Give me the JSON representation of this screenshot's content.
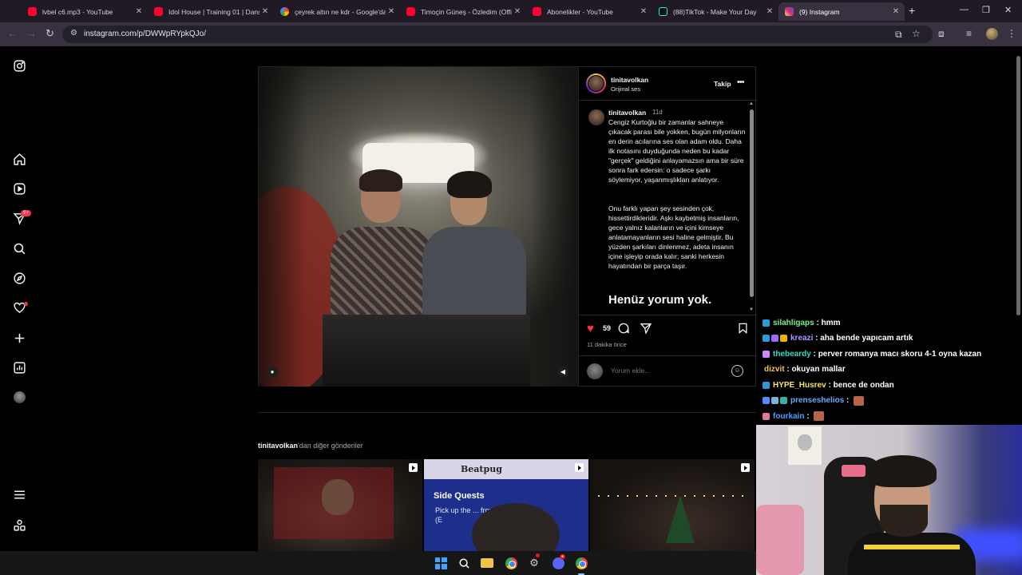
{
  "browser": {
    "tabs": [
      {
        "title": "lvbel c6.mp3 - YouTube",
        "icon": "youtube-icon",
        "fav": "yt"
      },
      {
        "title": "Idol House | Training 01 | Dans",
        "icon": "youtube-icon",
        "fav": "yt"
      },
      {
        "title": "çeyrek altın ne kdr - Google'da",
        "icon": "google-icon",
        "fav": "g"
      },
      {
        "title": "Timoçin Güneş - Özledim (Offic",
        "icon": "youtube-icon",
        "fav": "yt"
      },
      {
        "title": "Abonelikler - YouTube",
        "icon": "youtube-icon",
        "fav": "yt"
      },
      {
        "title": "(88)TikTok - Make Your Day",
        "icon": "tiktok-icon",
        "fav": "tt"
      },
      {
        "title": "(9) Instagram",
        "icon": "instagram-icon",
        "fav": "ig",
        "active": true
      }
    ],
    "url": "instagram.com/p/DWWpRYpkQJo/"
  },
  "nav": {
    "notification_badge": "9+"
  },
  "post": {
    "username": "tinitavolkan",
    "audio": "Orijinal ses",
    "follow_label": "Takip",
    "caption_user": "tinitavolkan",
    "caption_time": "11d",
    "caption_p1": "Cengiz Kurtoğlu bir zamanlar sahneye çıkacak parası bile yokken, bugün milyonların en derin acılarına ses olan adam oldu. Daha ilk notasını duyduğunda neden bu kadar \"gerçek\" geldiğini anlayamazsın ama bir süre sonra fark edersin: o sadece şarkı söylemiyor, yaşanmışlıkları anlatıyor.",
    "caption_p2": "Onu farklı yapan şey sesinden çok, hissettirdikleridir. Aşkı kaybetmiş insanların, gece yalnız kalanların ve içini kimseye anlatamayanların sesi haline gelmiştir. Bu yüzden şarkıları dinlenmez, adeta insanın içine işleyip orada kalır; sanki herkesin hayatından bir parça taşır.",
    "no_comments": "Henüz yorum yok.",
    "likes": "59",
    "time_ago": "11 dakika önce",
    "comment_placeholder": "Yorum ekle..."
  },
  "more_posts": {
    "user": "tinitavolkan",
    "suffix": "'dan diğer gönderiler",
    "thumb2_title": "Beatpug",
    "thumb2_heading": "Side Quests",
    "thumb2_text": "Pick up the ... from Night ... Stor ... (E"
  },
  "chat": [
    {
      "user": "silahligaps",
      "color": "#7cf08a",
      "msg": "hmm",
      "badges": [
        "#2a9bd8"
      ]
    },
    {
      "user": "kreazi",
      "color": "#b693ff",
      "msg": "aha bende yapıcam artık",
      "badges": [
        "#2a9bd8",
        "#9b6bff",
        "#f0b400"
      ]
    },
    {
      "user": "thebeardy",
      "color": "#38d9c7",
      "msg": "perver romanya macı skoru 4-1 oyna kazan",
      "badges": [
        "#c78bff"
      ]
    },
    {
      "user": "dizvit",
      "color": "#f5c542",
      "msg": "okuyan mallar",
      "badges": []
    },
    {
      "user": "HYPE_Husrev",
      "color": "#f7e36a",
      "msg": "bence de ondan",
      "badges": [
        "#2a9bd8"
      ]
    },
    {
      "user": "prenseshelios",
      "color": "#6aa8ff",
      "msg": "",
      "badges": [
        "#4d8bff",
        "#7fb0d8",
        "#38b2a0"
      ],
      "emote": true
    },
    {
      "user": "fourkain",
      "color": "#4aa0ff",
      "msg": "",
      "badges": [
        "#e07a9a"
      ],
      "emote": true
    }
  ],
  "colors": {
    "like": "#ff3040",
    "bg": "#000000"
  }
}
